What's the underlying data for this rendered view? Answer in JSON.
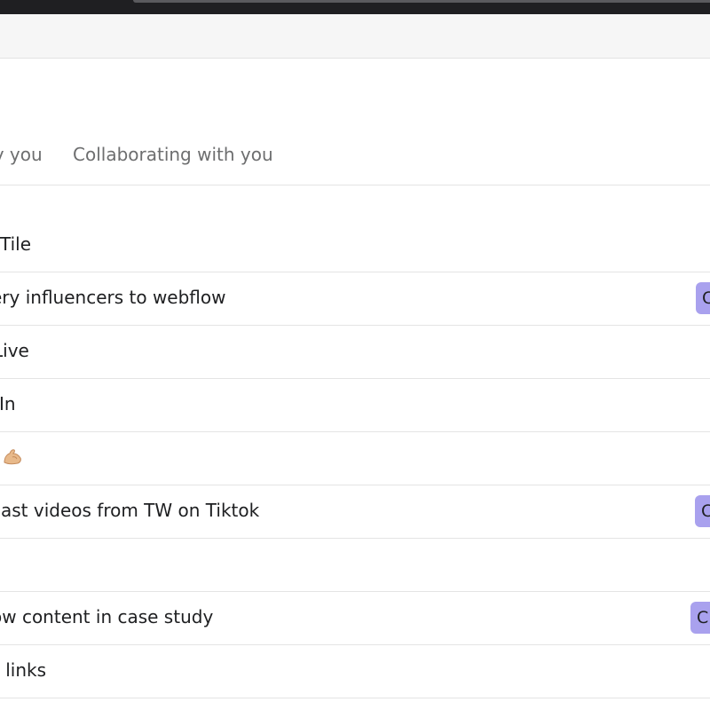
{
  "tabs": {
    "left_label": "by you",
    "right_label": "Collaborating with you"
  },
  "tasks": [
    {
      "title": "Tile",
      "pill": ""
    },
    {
      "title": "ery influencers to webflow",
      "pill": "C"
    },
    {
      "title": "Live",
      "pill": ""
    },
    {
      "title": "In",
      "pill": ""
    },
    {
      "title": "",
      "pill": "",
      "icon": "flexed-biceps-icon"
    },
    {
      "title": "cast videos from TW on Tiktok",
      "pill": "C"
    },
    {
      "title": "",
      "pill": ""
    },
    {
      "title": "ow content in case study",
      "pill": "C"
    },
    {
      "title": "t links",
      "pill": ""
    }
  ],
  "colors": {
    "pill": "#a9a1ee",
    "text": "#1e1f21",
    "muted": "#6d6e6f",
    "border": "#e4e4e4"
  }
}
